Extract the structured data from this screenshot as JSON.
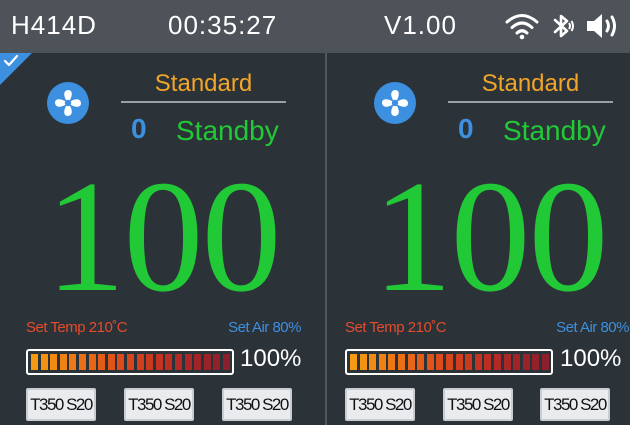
{
  "status_bar": {
    "model": "H414D",
    "time": "00:35:27",
    "version": "V1.00",
    "icons": [
      "wifi-icon",
      "bluetooth-icon",
      "volume-icon"
    ]
  },
  "colors": {
    "background": "#2c3338",
    "status_bar": "#4d5359",
    "accent_blue": "#3d8fe0",
    "green": "#22c937",
    "orange": "#f1a529",
    "red": "#e64b2c"
  },
  "channels": [
    {
      "selected": true,
      "mode": "Standard",
      "count": "0",
      "state": "Standby",
      "temperature": "100",
      "set_temp_label": "Set Temp 210˚C",
      "set_air_label": "Set Air 80%",
      "power_percent": "100%",
      "power_fraction": 1.0,
      "presets": [
        "T350 S20",
        "T350 S20",
        "T350 S20"
      ]
    },
    {
      "selected": false,
      "mode": "Standard",
      "count": "0",
      "state": "Standby",
      "temperature": "100",
      "set_temp_label": "Set Temp 210˚C",
      "set_air_label": "Set Air 80%",
      "power_percent": "100%",
      "power_fraction": 1.0,
      "presets": [
        "T350 S20",
        "T350 S20",
        "T350 S20"
      ]
    }
  ]
}
